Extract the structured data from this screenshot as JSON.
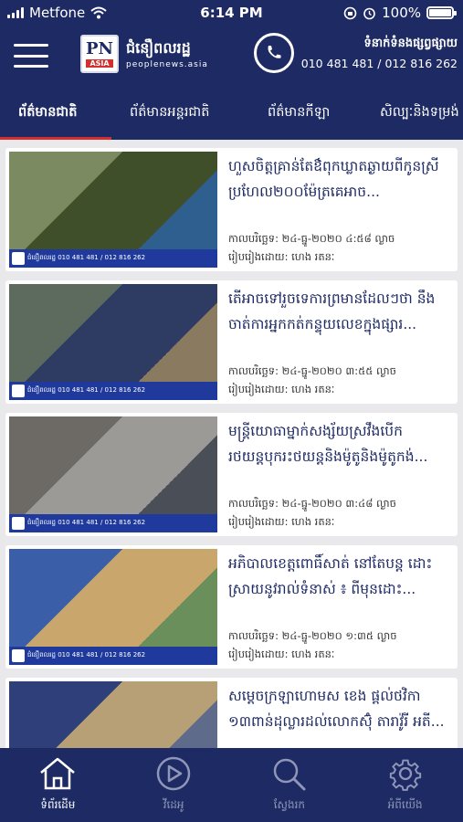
{
  "status_bar": {
    "carrier": "Metfone",
    "time": "6:14 PM",
    "battery": "100%",
    "battery_level": 1.0
  },
  "header": {
    "logo_mark": "PN",
    "logo_sub": "ASIA",
    "logo_name_kh": "ជំនឿពលរដ្ឋ",
    "logo_domain": "peoplenews.asia",
    "contact_label": "ទំនាក់ទំនងផ្សព្វផ្សាយ",
    "contact_phones": "010 481 481 / 012 816 262"
  },
  "tabs": [
    {
      "label": "ព័ត៌មានជាតិ",
      "active": true
    },
    {
      "label": "ព័ត៌មានអន្តរជាតិ",
      "active": false
    },
    {
      "label": "ព័ត៌មានកីឡា",
      "active": false
    },
    {
      "label": "សិល្បៈនិងទម្រង់",
      "active": false
    }
  ],
  "articles": [
    {
      "title": "ហួសចិត្តគ្រាន់តែឳពុកឃ្លាតឆ្ងាយពីកូនស្រីប្រហែល២០០ម៉ែត្រគេអាច...",
      "date": "កាលបរិច្ឆេទ: ២៤-ធ្នូ-២០២០ ៤:៥៨ ល្ងាច",
      "author": "រៀបរៀងដោយ: ហេង រតនៈ",
      "band_text": "ជំនឿពលរដ្ឋ  010 481 481 / 012 816 262",
      "palette": [
        "#7b8a60",
        "#3f4f2a",
        "#2f5f8f"
      ]
    },
    {
      "title": "តើអាចទៅរួចទេការព្រមានដែលៗថា នឹងចាត់ការអ្នកកត់កន្ទុយលេខក្នុងផ្សារ...",
      "date": "កាលបរិច្ឆេទ: ២៤-ធ្នូ-២០២០ ៣:៥៥ ល្ងាច",
      "author": "រៀបរៀងដោយ: ហេង រតនៈ",
      "band_text": "ជំនឿពលរដ្ឋ  010 481 481 / 012 816 262",
      "palette": [
        "#5c6b5e",
        "#2e3b63",
        "#8a7a60"
      ]
    },
    {
      "title": "មន្ត្រីយោធាម្នាក់សង្ស័យស្រវឹងបើករថយន្តបុករះថយន្តនិងម៉ូតូនិងម៉ូតូកង់...",
      "date": "កាលបរិច្ឆេទ: ២៤-ធ្នូ-២០២០ ៣:៤៨ ល្ងាច",
      "author": "រៀបរៀងដោយ: ហេង រតនៈ",
      "band_text": "ជំនឿពលរដ្ឋ  010 481 481 / 012 816 262",
      "palette": [
        "#6d6a66",
        "#9b9a96",
        "#4a4f57"
      ]
    },
    {
      "title": "អភិបាលខេត្តពោធិ៍សាត់ នៅតែបន្ត ដោះស្រាយនូវរាល់ទំនាស់ ៖ ពីមុនដោះ...",
      "date": "កាលបរិច្ឆេទ: ២៤-ធ្នូ-២០២០ ១:៣៥ ល្ងាច",
      "author": "រៀបរៀងដោយ: ហេង រតនៈ",
      "band_text": "ជំនឿពលរដ្ឋ  010 481 481 / 012 816 262",
      "palette": [
        "#3a5fa8",
        "#c9a66b",
        "#6b8f5a"
      ]
    },
    {
      "title": "សម្តេចក្រឡាហោមស ខេង ផ្តល់ថវិកា ១៣ពាន់ដុល្លារដល់លោកស៊ុំ តារាវ៉ូរី អតី...",
      "date": "",
      "author": "",
      "band_text": "",
      "palette": [
        "#2e3f7a",
        "#b8a076",
        "#5f6b8a"
      ]
    }
  ],
  "bottom_nav": [
    {
      "label": "ទំព័រដើម",
      "icon": "home-icon",
      "active": true
    },
    {
      "label": "វីដេអូ",
      "icon": "play-circle-icon",
      "active": false
    },
    {
      "label": "ស្វែងរក",
      "icon": "search-icon",
      "active": false
    },
    {
      "label": "អំពីយើង",
      "icon": "gear-icon",
      "active": false
    }
  ],
  "colors": {
    "primary": "#1e2a63",
    "accent": "#d32f2f",
    "background": "#e9e9ec"
  }
}
